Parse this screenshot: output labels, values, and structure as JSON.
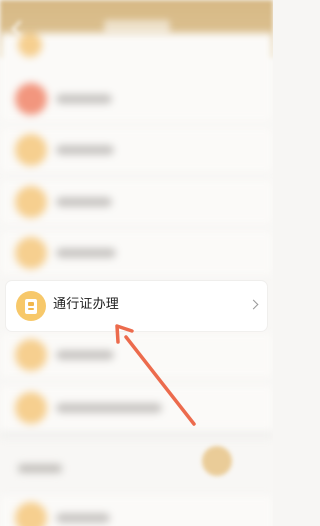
{
  "focused_item": {
    "label": "通行证办理",
    "icon": "pass-card-icon",
    "chevron_icon": "chevron-right-icon"
  },
  "annotation": {
    "arrow_color": "#ec6b4d",
    "icon": "arrow-pointer-icon"
  },
  "colors": {
    "header": "#d8bb88",
    "icon_background": "#f7c86a",
    "page_background": "#f8f7f5"
  }
}
